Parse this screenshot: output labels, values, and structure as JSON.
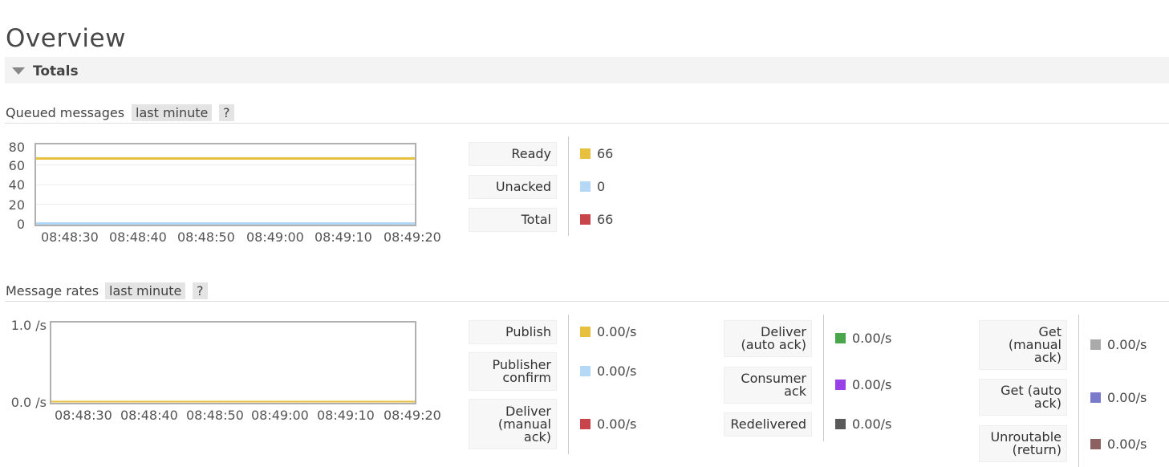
{
  "page": {
    "title": "Overview"
  },
  "totals": {
    "label": "Totals"
  },
  "queued": {
    "title": "Queued messages",
    "range": "last minute",
    "help": "?",
    "legend": [
      {
        "label": "Ready",
        "value": "66",
        "color": "#e8c040"
      },
      {
        "label": "Unacked",
        "value": "0",
        "color": "#b4d8f5"
      },
      {
        "label": "Total",
        "value": "66",
        "color": "#c8464b"
      }
    ]
  },
  "rates": {
    "title": "Message rates",
    "range": "last minute",
    "help": "?",
    "legend_col1": [
      {
        "label": "Publish",
        "value": "0.00/s",
        "color": "#e8c040"
      },
      {
        "label": "Publisher confirm",
        "value": "0.00/s",
        "color": "#b4d8f5"
      },
      {
        "label": "Deliver (manual ack)",
        "value": "0.00/s",
        "color": "#c8464b"
      }
    ],
    "legend_col2": [
      {
        "label": "Deliver (auto ack)",
        "value": "0.00/s",
        "color": "#4aa64a"
      },
      {
        "label": "Consumer ack",
        "value": "0.00/s",
        "color": "#9a40e8"
      },
      {
        "label": "Redelivered",
        "value": "0.00/s",
        "color": "#5a5a5a"
      }
    ],
    "legend_col3": [
      {
        "label": "Get (manual ack)",
        "value": "0.00/s",
        "color": "#aaaaaa"
      },
      {
        "label": "Get (auto ack)",
        "value": "0.00/s",
        "color": "#7a7acc"
      },
      {
        "label": "Unroutable (return)",
        "value": "0.00/s",
        "color": "#8c6060"
      }
    ]
  },
  "chart_data": [
    {
      "type": "line",
      "x": [
        "08:48:30",
        "08:48:40",
        "08:48:50",
        "08:49:00",
        "08:49:10",
        "08:49:20"
      ],
      "yticks": [
        "80",
        "60",
        "40",
        "20",
        "0"
      ],
      "ylim": [
        0,
        80
      ],
      "grid": true,
      "series": [
        {
          "name": "Ready",
          "values": [
            66,
            66,
            66,
            66,
            66,
            66
          ],
          "color": "#e8c040"
        },
        {
          "name": "Unacked",
          "values": [
            0,
            0,
            0,
            0,
            0,
            0
          ],
          "color": "#b4d8f5"
        },
        {
          "name": "Total",
          "values": [
            66,
            66,
            66,
            66,
            66,
            66
          ],
          "color": "#c8464b"
        }
      ]
    },
    {
      "type": "line",
      "x": [
        "08:48:30",
        "08:48:40",
        "08:48:50",
        "08:49:00",
        "08:49:10",
        "08:49:20"
      ],
      "yticks": [
        "1.0 /s",
        "0.0 /s"
      ],
      "ylim": [
        0,
        1
      ],
      "grid": false,
      "series": [
        {
          "name": "Publish",
          "values": [
            0,
            0,
            0,
            0,
            0,
            0
          ],
          "color": "#e8c040"
        },
        {
          "name": "Publisher confirm",
          "values": [
            0,
            0,
            0,
            0,
            0,
            0
          ],
          "color": "#b4d8f5"
        }
      ]
    }
  ]
}
